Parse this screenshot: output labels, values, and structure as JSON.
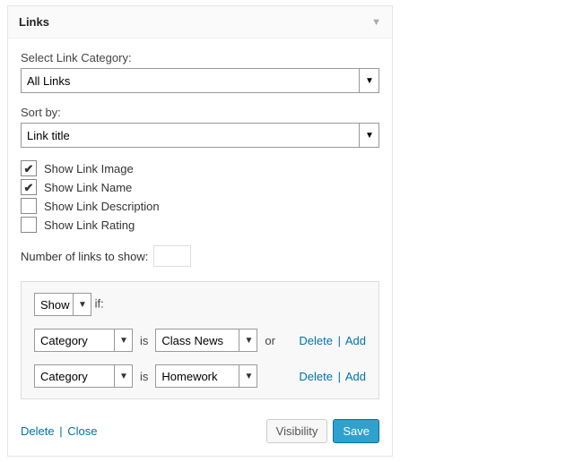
{
  "header": {
    "title": "Links"
  },
  "category": {
    "label": "Select Link Category:",
    "value": "All Links"
  },
  "sort": {
    "label": "Sort by:",
    "value": "Link title"
  },
  "checkboxes": {
    "image": {
      "label": "Show Link Image",
      "checked": true
    },
    "name": {
      "label": "Show Link Name",
      "checked": true
    },
    "description": {
      "label": "Show Link Description",
      "checked": false
    },
    "rating": {
      "label": "Show Link Rating",
      "checked": false
    }
  },
  "numLinks": {
    "label": "Number of links to show:",
    "value": ""
  },
  "visibility": {
    "action": "Show",
    "if": "if:",
    "is": "is",
    "or": "or",
    "rules": [
      {
        "field": "Category",
        "value": "Class News",
        "trailing": "or"
      },
      {
        "field": "Category",
        "value": "Homework",
        "trailing": ""
      }
    ],
    "delete": "Delete",
    "add": "Add"
  },
  "footer": {
    "delete": "Delete",
    "close": "Close",
    "visibility": "Visibility",
    "save": "Save"
  },
  "glyph": {
    "check": "✔",
    "caret": "▼"
  }
}
